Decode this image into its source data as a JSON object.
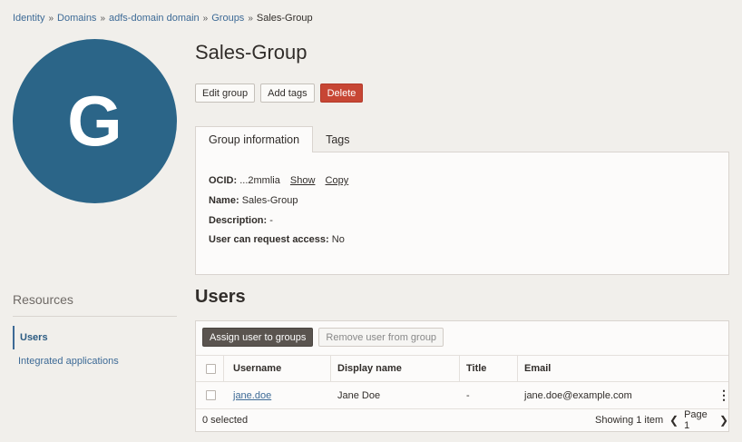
{
  "breadcrumb": {
    "items": [
      "Identity",
      "Domains",
      "adfs-domain domain",
      "Groups"
    ],
    "current": "Sales-Group",
    "separator": "»"
  },
  "avatar": {
    "letter": "G",
    "color": "#2b6588"
  },
  "page_title": "Sales-Group",
  "actions": {
    "edit": "Edit group",
    "add_tags": "Add tags",
    "delete": "Delete"
  },
  "tabs": {
    "group_info": "Group information",
    "tags": "Tags"
  },
  "group_info": {
    "ocid_label": "OCID:",
    "ocid_value": "...2mmlia",
    "show": "Show",
    "copy": "Copy",
    "name_label": "Name:",
    "name_value": "Sales-Group",
    "description_label": "Description:",
    "description_value": "-",
    "request_label": "User can request access:",
    "request_value": "No"
  },
  "resources": {
    "title": "Resources",
    "items": [
      "Users",
      "Integrated applications"
    ]
  },
  "users": {
    "title": "Users",
    "assign_button": "Assign user to groups",
    "remove_button": "Remove user from group",
    "columns": [
      "Username",
      "Display name",
      "Title",
      "Email"
    ],
    "rows": [
      {
        "username": "jane.doe",
        "display_name": "Jane Doe",
        "title": "-",
        "email": "jane.doe@example.com"
      }
    ],
    "selected_text": "0 selected",
    "showing_text": "Showing 1 item",
    "page_text": "Page 1"
  },
  "colors": {
    "accent": "#3d6a96",
    "danger": "#c74634",
    "background": "#f1efeb"
  }
}
